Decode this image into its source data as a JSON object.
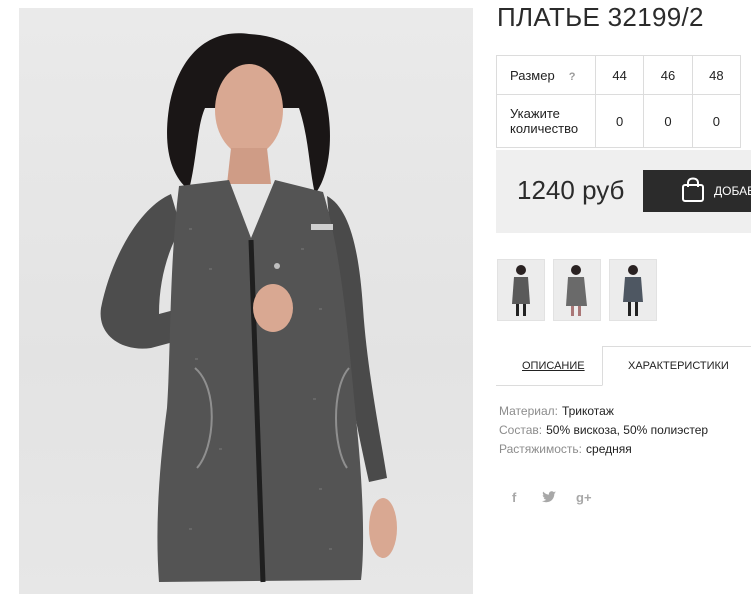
{
  "product": {
    "title": "ПЛАТЬЕ 32199/2",
    "main_image_alt": "model wearing grey melange zip dress"
  },
  "size_table": {
    "size_label": "Размер",
    "help_label": "?",
    "sizes": [
      "44",
      "46",
      "48"
    ],
    "quantity_label": "Укажите количество",
    "quantities": [
      "0",
      "0",
      "0"
    ]
  },
  "purchase": {
    "price": "1240 руб",
    "add_to_cart_label": "ДОБАВ"
  },
  "thumbnails": [
    {
      "name": "thumbnail-1"
    },
    {
      "name": "thumbnail-2"
    },
    {
      "name": "thumbnail-3"
    }
  ],
  "tabs": {
    "description": "ОПИСАНИЕ",
    "characteristics": "ХАРАКТЕРИСТИКИ"
  },
  "specs": [
    {
      "key": "Материал:",
      "value": "Трикотаж"
    },
    {
      "key": "Состав:",
      "value": "50% вискоза, 50% полиэстер"
    },
    {
      "key": "Растяжимость:",
      "value": "средняя"
    }
  ],
  "social": {
    "facebook": "f",
    "twitter": "twitter-icon",
    "google": "g+"
  },
  "colors": {
    "accent_dark": "#2b2b2b",
    "price_bg": "#efefef",
    "border": "#dcdcdc"
  }
}
